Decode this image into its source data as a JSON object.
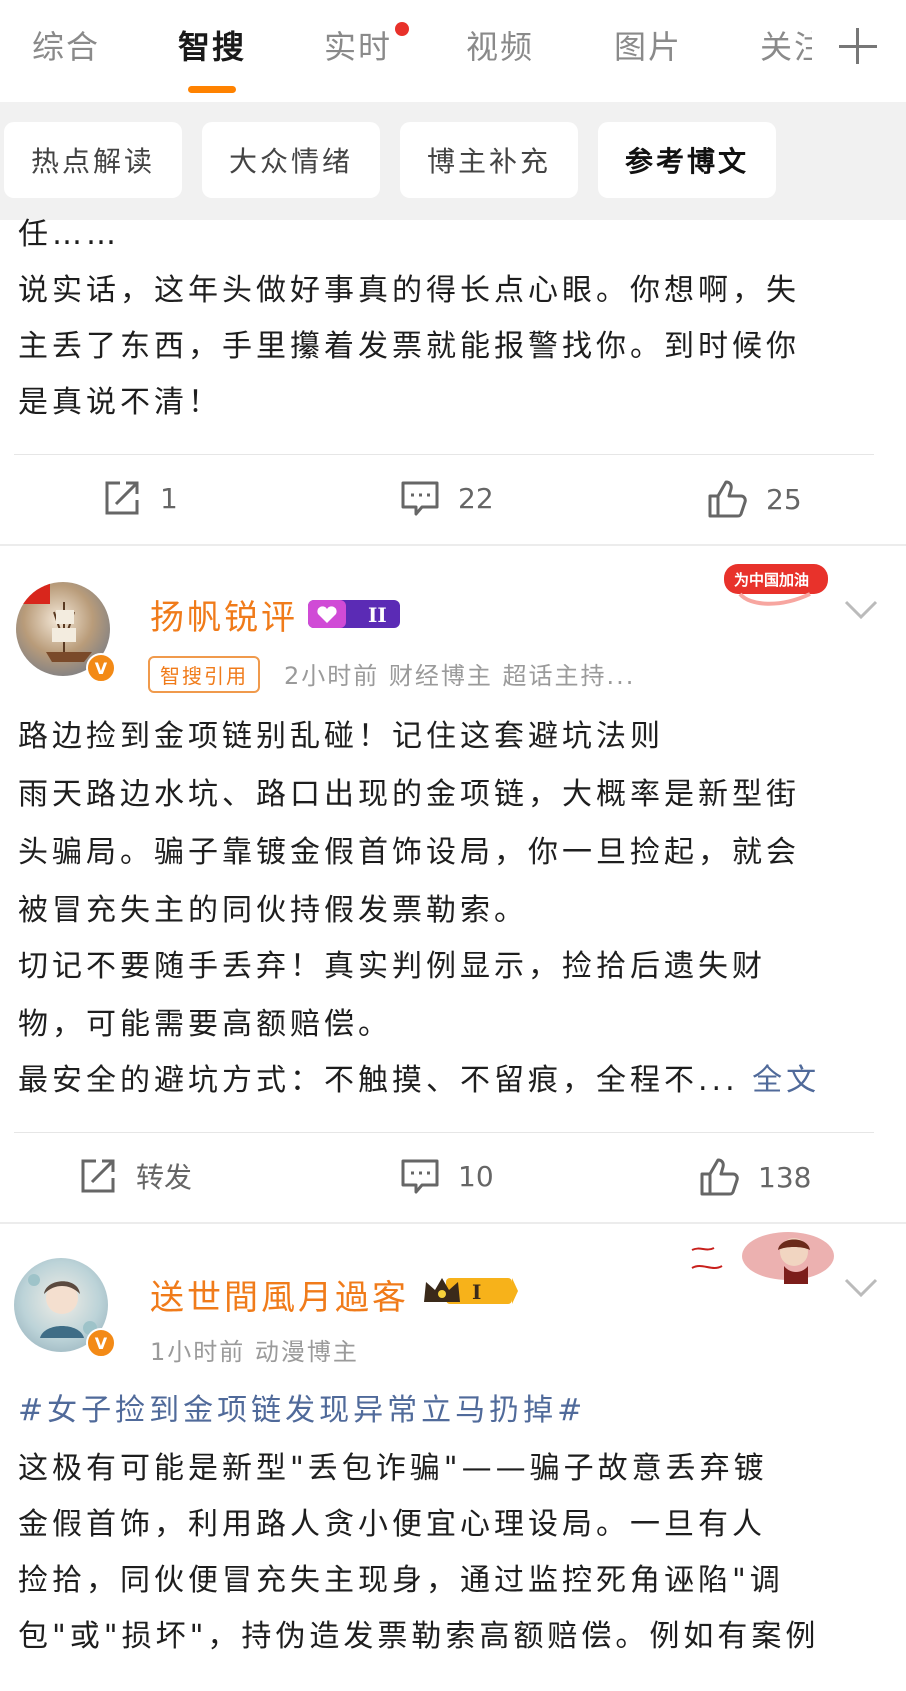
{
  "tabs": [
    "综合",
    "智搜",
    "实时",
    "视频",
    "图片",
    "关注"
  ],
  "filters": [
    "热点解读",
    "大众情绪",
    "博主补充",
    "参考博文"
  ],
  "post1": {
    "text_lines": [
      "任……",
      "说实话，这年头做好事真的得长点心眼。你想啊，失",
      "主丢了东西，手里攥着发票就能报警找你。到时候你",
      "是真说不清！"
    ],
    "repost_count": "1",
    "comment_count": "22",
    "like_count": "25"
  },
  "post2": {
    "author": "扬帆锐评",
    "level": "II",
    "tag": "智搜引用",
    "meta": "2小时前  财经博主 超话主持...",
    "badge_text": "为中国加油",
    "text_lines": [
      "路边捡到金项链别乱碰！记住这套避坑法则",
      "雨天路边水坑、路口出现的金项链，大概率是新型街",
      "头骗局。骗子靠镀金假首饰设局，你一旦捡起，就会",
      "被冒充失主的同伙持假发票勒索。",
      "切记不要随手丢弃！真实判例显示，捡拾后遗失财",
      "物，可能需要高额赔偿。",
      "最安全的避坑方式：不触摸、不留痕，全程不..."
    ],
    "full_text_link": "全文",
    "repost_label": "转发",
    "comment_count": "10",
    "like_count": "138"
  },
  "post3": {
    "author": "送世間風月過客",
    "level": "I",
    "meta": "1小时前  动漫博主",
    "hashtag": "#女子捡到金项链发现异常立马扔掉#",
    "text_lines": [
      "这极有可能是新型\"丢包诈骗\"——骗子故意丢弃镀",
      "金假首饰，利用路人贪小便宜心理设局。一旦有人",
      "捡拾，同伙便冒充失主现身，通过监控死角诬陷\"调",
      "包\"或\"损坏\"，持伪造发票勒索高额赔偿。例如有案例"
    ]
  },
  "colors": {
    "accent": "#ff8200",
    "author": "#f07b1a",
    "link": "#506a9a",
    "red_dot": "#e8312a"
  },
  "icons": [
    "plus-icon",
    "repost-icon",
    "comment-icon",
    "like-icon",
    "chevron-down-icon",
    "verified-icon"
  ]
}
